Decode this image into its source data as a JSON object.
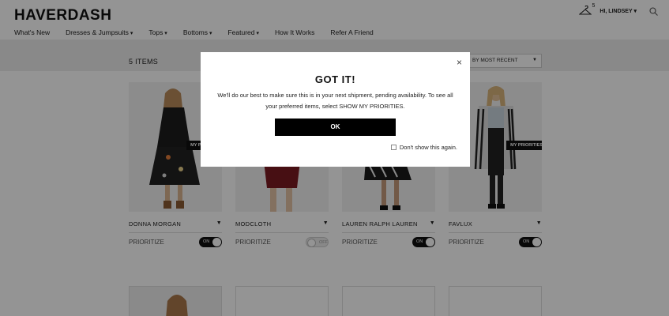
{
  "header": {
    "logo": "HAVERDASH",
    "nav": [
      {
        "label": "What's New",
        "caret": false
      },
      {
        "label": "Dresses & Jumpsuits",
        "caret": true
      },
      {
        "label": "Tops",
        "caret": true
      },
      {
        "label": "Bottoms",
        "caret": true
      },
      {
        "label": "Featured",
        "caret": true
      },
      {
        "label": "How It Works",
        "caret": false
      },
      {
        "label": "Refer A Friend",
        "caret": false
      }
    ],
    "hanger_count": "5",
    "greeting": "HI, LINDSEY",
    "greeting_caret": "▾"
  },
  "listing": {
    "items_count": "5 ITEMS",
    "sort_label": "BY MOST RECENT",
    "prioritize_label": "PRIORITIZE",
    "badge_label": "MY PRIORITIES",
    "toggle_on": "ON",
    "toggle_off": "OFF",
    "products": [
      {
        "brand": "DONNA MORGAN",
        "on": true,
        "badge": true
      },
      {
        "brand": "MODCLOTH",
        "on": false,
        "badge": false
      },
      {
        "brand": "LAUREN RALPH LAUREN",
        "on": true,
        "badge": false
      },
      {
        "brand": "FAVLUX",
        "on": true,
        "badge": true
      }
    ]
  },
  "modal": {
    "close": "×",
    "title": "GOT IT!",
    "body": "We'll do our best to make sure this is in your next shipment, pending availability. To see all your preferred items, select SHOW MY PRIORITIES.",
    "ok_label": "OK",
    "checkbox_label": "Don't show this again."
  },
  "colors": {
    "accent": "#000000",
    "overlay": "rgba(0,0,0,0.42)"
  }
}
